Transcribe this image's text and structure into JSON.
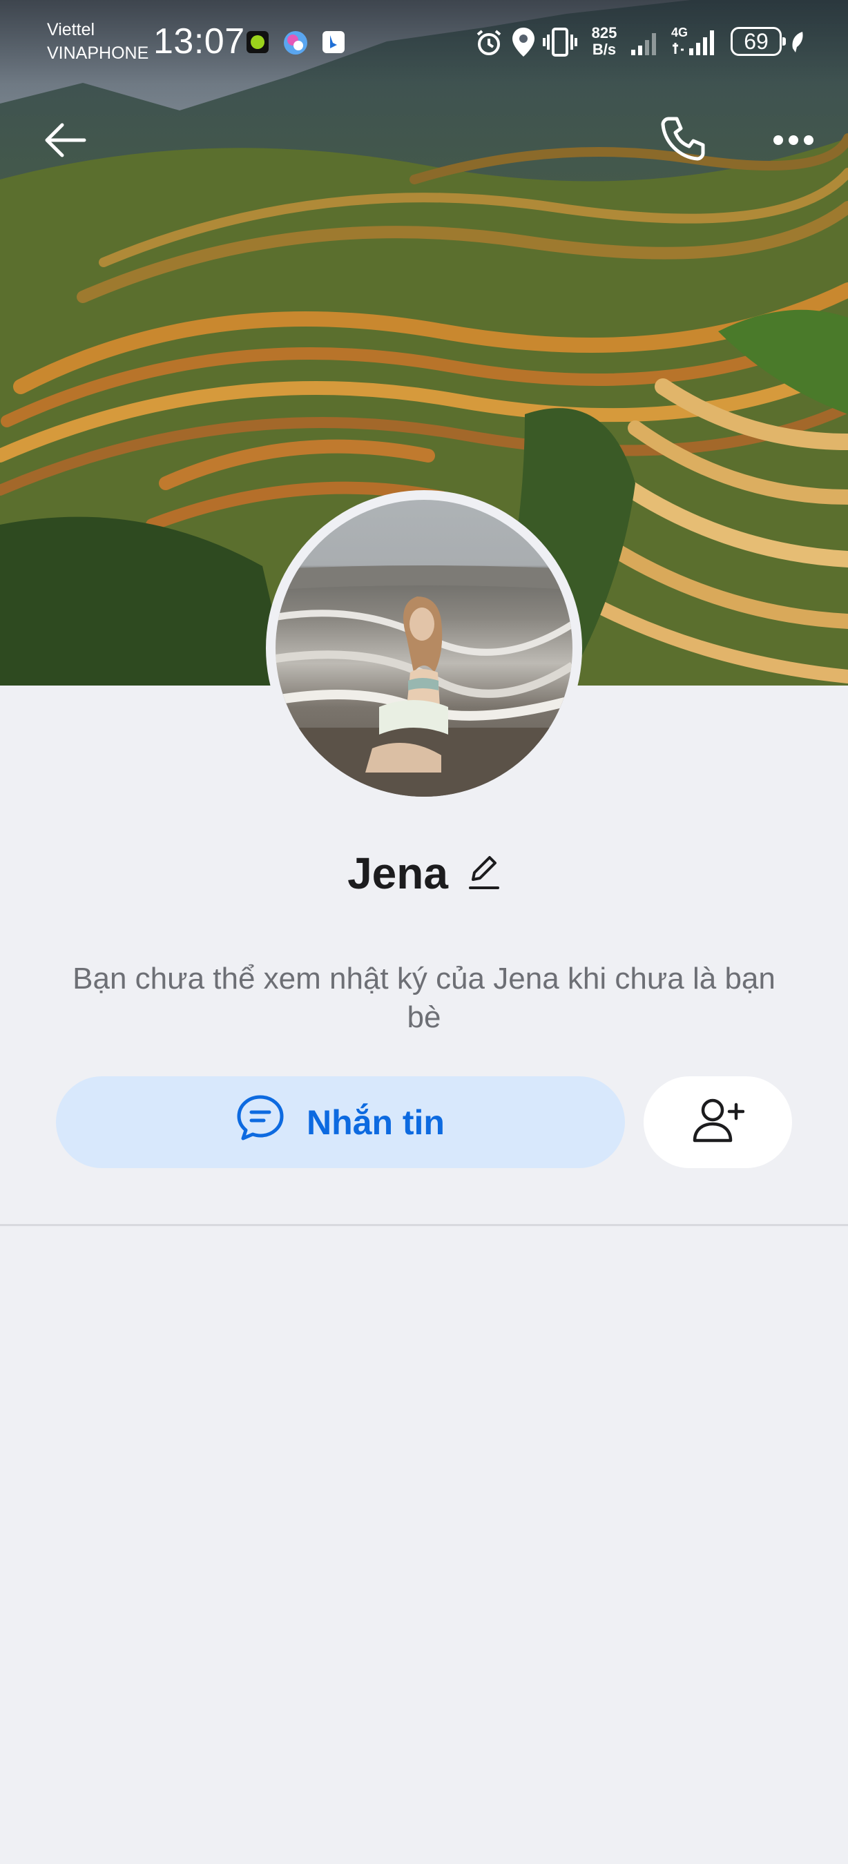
{
  "status_bar": {
    "carrier_1": "Viettel",
    "carrier_2": "VINAPHONE",
    "time": "13:07",
    "speed_value": "825",
    "speed_unit": "B/s",
    "network_type": "4G",
    "battery": "69",
    "icons": [
      "app-notification-icon",
      "app-notification-icon",
      "app-notification-icon",
      "alarm-icon",
      "location-icon",
      "vibrate-icon",
      "signal-icon",
      "signal-icon",
      "battery-saver-icon"
    ]
  },
  "nav": {
    "icons": [
      "back-arrow-icon",
      "phone-icon",
      "more-icon"
    ]
  },
  "profile": {
    "name": "Jena",
    "notice": "Bạn chưa thể xem nhật ký của Jena khi chưa là bạn bè",
    "message_button": "Nhắn tin",
    "icons": [
      "edit-pencil-icon",
      "chat-bubble-icon",
      "add-friend-icon"
    ]
  },
  "colors": {
    "background": "#eff0f4",
    "accent": "#0d6ae0",
    "message_button_bg": "#d8e8fc",
    "text_primary": "#1c1c1e",
    "text_secondary": "#6d6f75"
  }
}
